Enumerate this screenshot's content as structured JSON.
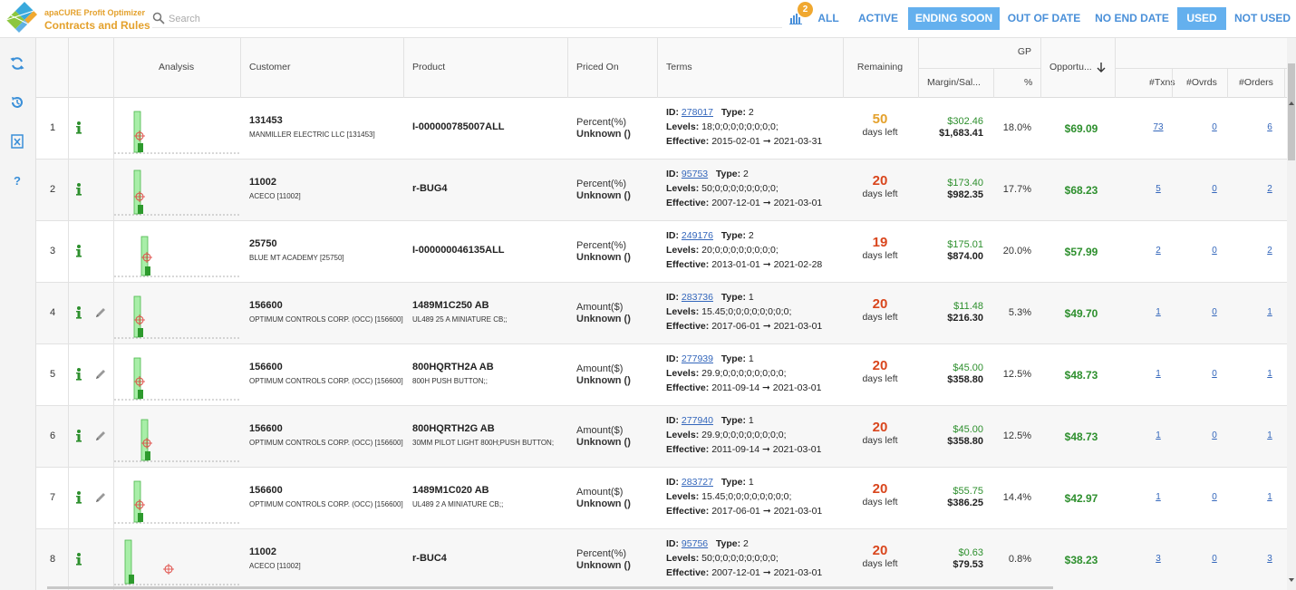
{
  "header": {
    "brand_sub": "apaCURE Profit Optimizer",
    "brand_title": "Contracts and Rules",
    "search_placeholder": "Search",
    "badge_count": "2",
    "filters": [
      {
        "label": "ALL",
        "active": false
      },
      {
        "label": "ACTIVE",
        "active": false
      },
      {
        "label": "ENDING SOON",
        "active": true
      },
      {
        "label": "OUT OF DATE",
        "active": false
      },
      {
        "label": "NO END DATE",
        "active": false
      },
      {
        "label": "USED",
        "active": true
      },
      {
        "label": "NOT USED",
        "active": false
      }
    ]
  },
  "sidebar": {
    "icons": [
      "refresh-icon",
      "history-icon",
      "excel-export-icon",
      "help-icon"
    ]
  },
  "columns": {
    "analysis": "Analysis",
    "customer": "Customer",
    "product": "Product",
    "priced_on": "Priced On",
    "terms": "Terms",
    "remaining": "Remaining",
    "gp": "GP",
    "margin_sales": "Margin/Sal...",
    "pct": "%",
    "opportunity": "Opportu...",
    "txns": "#Txns",
    "ovrds": "#Ovrds",
    "orders": "#Orders"
  },
  "labels": {
    "id": "ID:",
    "type": "Type:",
    "levels": "Levels:",
    "effective": "Effective:",
    "arrow": "➞",
    "days_left": "days left"
  },
  "colors": {
    "accent": "#64b0ee",
    "link": "#3366bb",
    "green": "#2d8f2d",
    "orange": "#e4a12c",
    "red": "#d9461d"
  },
  "rows": [
    {
      "num": "1",
      "editable": false,
      "cust_id": "131453",
      "cust_name": "MANMILLER ELECTRIC LLC [131453]",
      "prod_code": "I-000000785007ALL",
      "prod_desc": "",
      "priced_on": "Percent(%)",
      "priced_unknown": "Unknown ()",
      "term_id": "278017",
      "term_type": "2",
      "levels": "18;0;0;0;0;0;0;0;0;",
      "eff_start": "2015-02-01",
      "eff_end": "2021-03-31",
      "remaining": "50",
      "remaining_color": "#e4a12c",
      "margin": "$302.46",
      "sales": "$1,683.41",
      "pct": "18.0%",
      "opp": "$69.09",
      "txns": "73",
      "ovrds": "0",
      "orders": "6",
      "bar_fraction": 0.9,
      "marker_fraction": 0.28
    },
    {
      "num": "2",
      "editable": false,
      "cust_id": "11002",
      "cust_name": "ACECO [11002]",
      "prod_code": "r-BUG4",
      "prod_desc": "",
      "priced_on": "Percent(%)",
      "priced_unknown": "Unknown ()",
      "term_id": "95753",
      "term_type": "2",
      "levels": "50;0;0;0;0;0;0;0;0;",
      "eff_start": "2007-12-01",
      "eff_end": "2021-03-01",
      "remaining": "20",
      "remaining_color": "#d9461d",
      "margin": "$173.40",
      "sales": "$982.35",
      "pct": "17.7%",
      "opp": "$68.23",
      "txns": "5",
      "ovrds": "0",
      "orders": "2",
      "bar_fraction": 0.95,
      "marker_fraction": 0.3
    },
    {
      "num": "3",
      "editable": false,
      "cust_id": "25750",
      "cust_name": "BLUE MT ACADEMY [25750]",
      "prod_code": "I-000000046135ALL",
      "prod_desc": "",
      "priced_on": "Percent(%)",
      "priced_unknown": "Unknown ()",
      "term_id": "249176",
      "term_type": "2",
      "levels": "20;0;0;0;0;0;0;0;0;",
      "eff_start": "2013-01-01",
      "eff_end": "2021-02-28",
      "remaining": "19",
      "remaining_color": "#d9461d",
      "margin": "$175.01",
      "sales": "$874.00",
      "pct": "20.0%",
      "opp": "$57.99",
      "txns": "2",
      "ovrds": "0",
      "orders": "2",
      "bar_fraction": 0.85,
      "marker_fraction": 0.33
    },
    {
      "num": "4",
      "editable": true,
      "cust_id": "156600",
      "cust_name": "OPTIMUM CONTROLS CORP. (OCC) [156600]",
      "prod_code": "1489M1C250 AB",
      "prod_desc": "UL489 25 A MINIATURE CB;;",
      "priced_on": "Amount($)",
      "priced_unknown": "Unknown ()",
      "term_id": "283736",
      "term_type": "1",
      "levels": "15.45;0;0;0;0;0;0;0;0;",
      "eff_start": "2017-06-01",
      "eff_end": "2021-03-01",
      "remaining": "20",
      "remaining_color": "#d9461d",
      "margin": "$11.48",
      "sales": "$216.30",
      "pct": "5.3%",
      "opp": "$49.70",
      "txns": "1",
      "ovrds": "0",
      "orders": "1",
      "bar_fraction": 0.9,
      "marker_fraction": 0.3
    },
    {
      "num": "5",
      "editable": true,
      "cust_id": "156600",
      "cust_name": "OPTIMUM CONTROLS CORP. (OCC) [156600]",
      "prod_code": "800HQRTH2A AB",
      "prod_desc": "800H PUSH BUTTON;;",
      "priced_on": "Amount($)",
      "priced_unknown": "Unknown ()",
      "term_id": "277939",
      "term_type": "1",
      "levels": "29.9;0;0;0;0;0;0;0;0;",
      "eff_start": "2011-09-14",
      "eff_end": "2021-03-01",
      "remaining": "20",
      "remaining_color": "#d9461d",
      "margin": "$45.00",
      "sales": "$358.80",
      "pct": "12.5%",
      "opp": "$48.73",
      "txns": "1",
      "ovrds": "0",
      "orders": "1",
      "bar_fraction": 0.9,
      "marker_fraction": 0.3
    },
    {
      "num": "6",
      "editable": true,
      "cust_id": "156600",
      "cust_name": "OPTIMUM CONTROLS CORP. (OCC) [156600]",
      "prod_code": "800HQRTH2G AB",
      "prod_desc": "30MM PILOT LIGHT 800H;PUSH BUTTON;",
      "priced_on": "Amount($)",
      "priced_unknown": "Unknown ()",
      "term_id": "277940",
      "term_type": "1",
      "levels": "29.9;0;0;0;0;0;0;0;0;",
      "eff_start": "2011-09-14",
      "eff_end": "2021-03-01",
      "remaining": "20",
      "remaining_color": "#d9461d",
      "margin": "$45.00",
      "sales": "$358.80",
      "pct": "12.5%",
      "opp": "$48.73",
      "txns": "1",
      "ovrds": "0",
      "orders": "1",
      "bar_fraction": 0.9,
      "marker_fraction": 0.3
    },
    {
      "num": "7",
      "editable": true,
      "cust_id": "156600",
      "cust_name": "OPTIMUM CONTROLS CORP. (OCC) [156600]",
      "prod_code": "1489M1C020 AB",
      "prod_desc": "UL489 2 A MINIATURE CB;;",
      "priced_on": "Amount($)",
      "priced_unknown": "Unknown ()",
      "term_id": "283727",
      "term_type": "1",
      "levels": "15.45;0;0;0;0;0;0;0;0;",
      "eff_start": "2017-06-01",
      "eff_end": "2021-03-01",
      "remaining": "20",
      "remaining_color": "#d9461d",
      "margin": "$55.75",
      "sales": "$386.25",
      "pct": "14.4%",
      "opp": "$42.97",
      "txns": "1",
      "ovrds": "0",
      "orders": "1",
      "bar_fraction": 0.9,
      "marker_fraction": 0.3
    },
    {
      "num": "8",
      "editable": false,
      "cust_id": "11002",
      "cust_name": "ACECO [11002]",
      "prod_code": "r-BUC4",
      "prod_desc": "",
      "priced_on": "Percent(%)",
      "priced_unknown": "Unknown ()",
      "term_id": "95756",
      "term_type": "2",
      "levels": "50;0;0;0;0;0;0;0;0;",
      "eff_start": "2007-12-01",
      "eff_end": "2021-03-01",
      "remaining": "20",
      "remaining_color": "#d9461d",
      "margin": "$0.63",
      "sales": "$79.53",
      "pct": "0.8%",
      "opp": "$38.23",
      "txns": "3",
      "ovrds": "0",
      "orders": "3",
      "bar_fraction": 0.95,
      "marker_fraction": 0.25
    }
  ]
}
